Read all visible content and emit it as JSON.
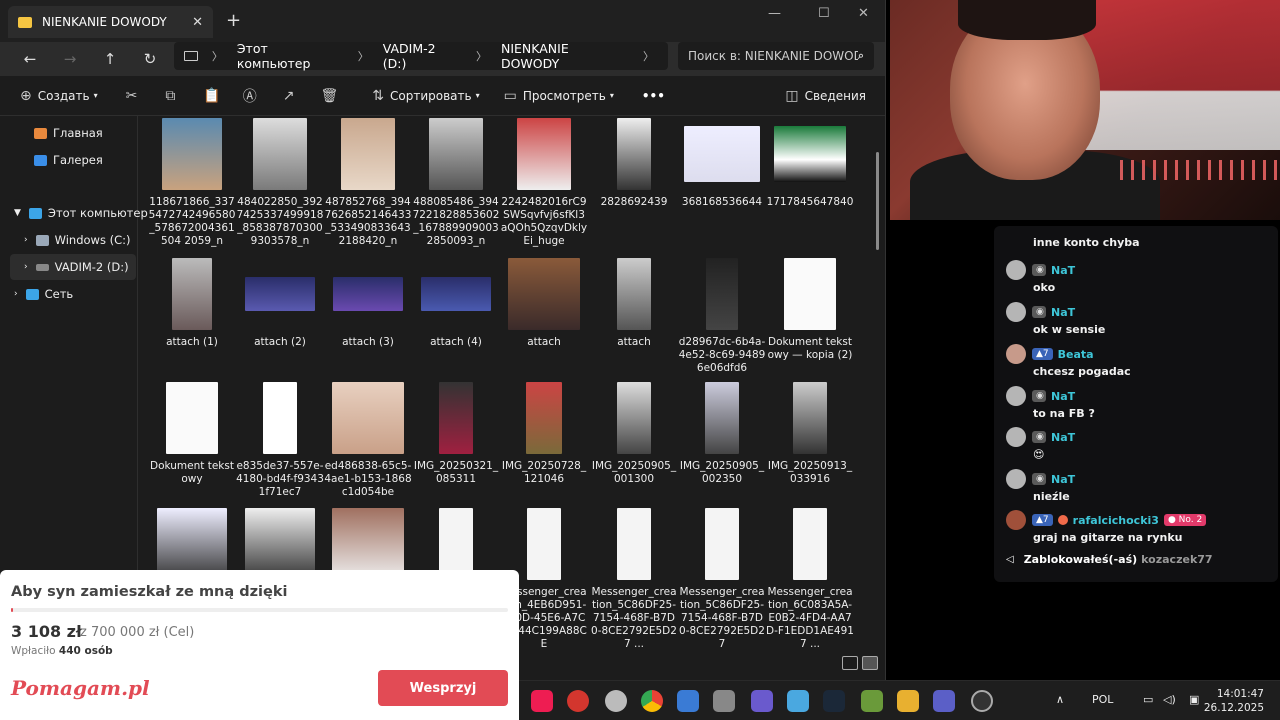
{
  "explorer": {
    "tab_title": "NIENKANIE DOWODY",
    "breadcrumbs": [
      "Этот компьютер",
      "VADIM-2 (D:)",
      "NIENKANIE DOWODY"
    ],
    "search_placeholder": "Поиск в: NIENKANIE DOWODY",
    "toolbar": {
      "create": "Создать",
      "sort": "Сортировать",
      "view": "Просмотреть",
      "more": "•••",
      "details": "Сведения"
    },
    "sidebar": {
      "home": "Главная",
      "gallery": "Галерея",
      "this_pc": "Этот компьютер",
      "windows_c": "Windows (C:)",
      "vadim_d": "VADIM-2 (D:)",
      "network": "Сеть"
    },
    "files": [
      "118671866_3375472742496580_578672004361504 2059_n",
      "484022850_3927425337499918_8583878703009303578_n",
      "487852768_3947626852146433_5334908336432188420_n",
      "488085486_3947221828853602_1678899090032850093_n",
      "2242482016rC9SWSqvfvj6sfKl3aQOh5QzqvDklyEi_huge",
      "2828692439",
      "368168536644",
      "1717845647840",
      "attach (1)",
      "attach (2)",
      "attach (3)",
      "attach (4)",
      "attach",
      "attach",
      "d28967dc-6b4a-4e52-8c69-94896e06dfd6",
      "Dokument tekstowy — kopia (2)",
      "Dokument tekstowy",
      "e835de37-557e-4180-bd4f-f93431f71ec7",
      "ed486838-65c5-4ae1-b153-1868c1d054be",
      "IMG_20250321_085311",
      "IMG_20250728_121046",
      "IMG_20250905_001300",
      "IMG_20250905_002350",
      "IMG_20250913_033916",
      "",
      "",
      "",
      "",
      "Messenger_creation_4EB6D951-F80D-45E6-A7C0-044C199A88CE",
      "Messenger_creation_5C86DF25-7154-468F-B7D0-8CE2792E5D27 ...",
      "Messenger_creation_5C86DF25-7154-468F-B7D0-8CE2792E5D27",
      "Messenger_creation_6C083A5A-E0B2-4FD4-AA7D-F1EDD1AE4917 ..."
    ]
  },
  "chat": {
    "messages": [
      {
        "user": "",
        "text": "inne konto chyba"
      },
      {
        "user": "NaT",
        "text": "oko"
      },
      {
        "user": "NaT",
        "text": "ok w sensie"
      },
      {
        "user": "Beata",
        "level": "7",
        "text": "chcesz pogadac"
      },
      {
        "user": "NaT",
        "text": "to na FB ?"
      },
      {
        "user": "NaT",
        "text": "😍"
      },
      {
        "user": "NaT",
        "text": "nieźle"
      },
      {
        "user": "rafalcichocki3",
        "level": "7",
        "rank": "No. 2",
        "text": "graj na gitarze na rynku"
      }
    ],
    "blocked_label": "Zablokowałeś(-aś)",
    "blocked_user": "kozaczek77"
  },
  "fund": {
    "title": "Aby syn zamieszkał ze mną dzięki",
    "raised": "3 108 zł",
    "goal": "z 700 000 zł (Cel)",
    "paid_prefix": "Wpłaciło",
    "paid_count": "440 osób",
    "progress": 0.0044,
    "logo": "Pomagam.pl",
    "button": "Wesprzyj"
  },
  "taskbar": {
    "lang": "POL",
    "time": "14:01:47",
    "date": "26.12.2025"
  },
  "colors": {
    "accent": "#e24b55",
    "chat_username": "#3ec6d8",
    "level_badge": "#3a64b8"
  }
}
